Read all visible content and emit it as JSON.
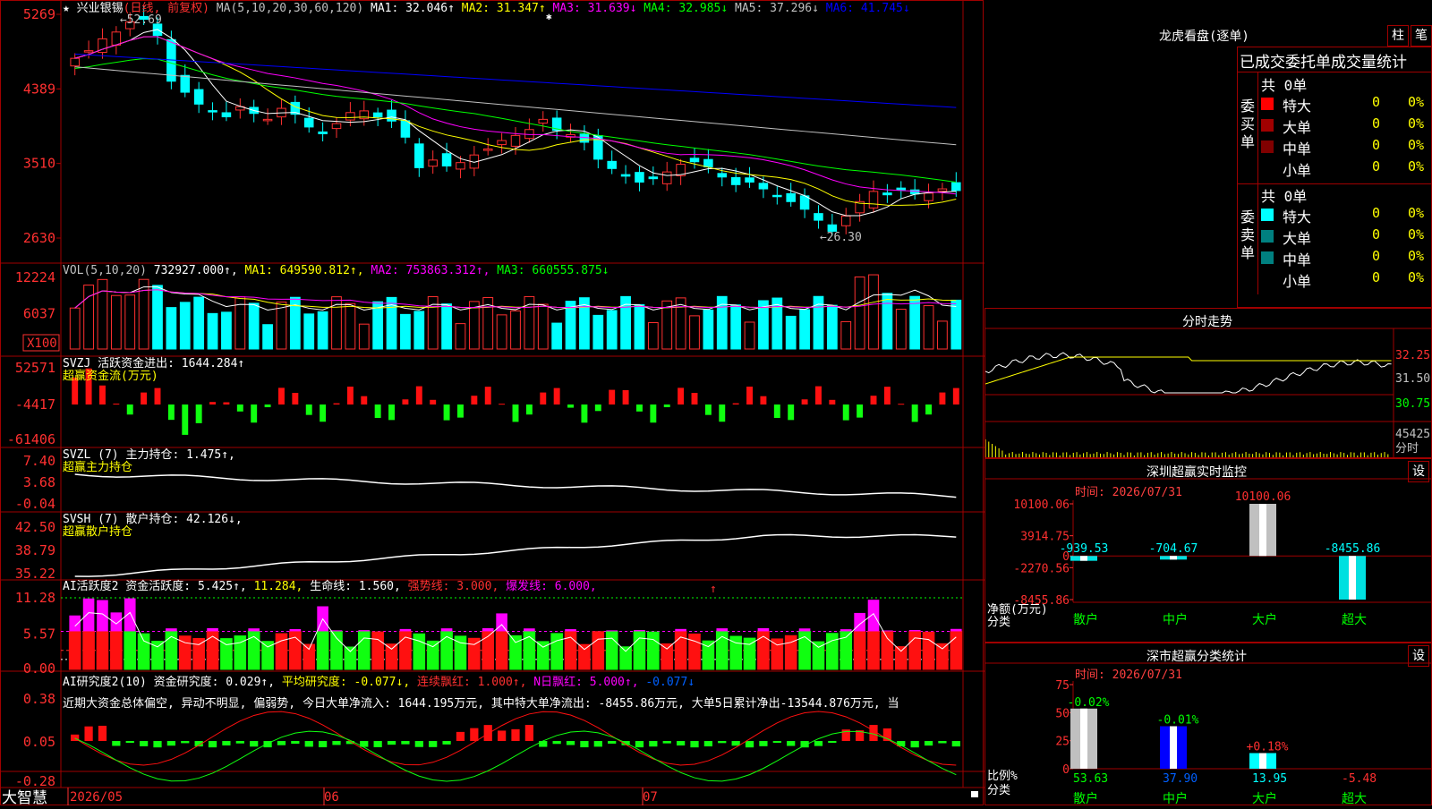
{
  "stock": {
    "star": "★",
    "name": "兴业银锡",
    "mode": "(日线, 前复权)",
    "ma_prefix": "MA(5,10,20,30,60,120)",
    "ma": [
      {
        "label": "MA1: 32.046↑",
        "color": "#ffffff"
      },
      {
        "label": "MA2: 31.347↑",
        "color": "#ffff00"
      },
      {
        "label": "MA3: 31.639↓",
        "color": "#ff00ff"
      },
      {
        "label": "MA4: 32.985↓",
        "color": "#00ff00"
      },
      {
        "label": "MA5: 37.296↓",
        "color": "#c0c0c0"
      },
      {
        "label": "MA6: 41.745↓",
        "color": "#0000ff"
      }
    ],
    "high_mark": "52.69",
    "low_mark": "26.30"
  },
  "price_axis": [
    "5269",
    "4389",
    "3510",
    "2630"
  ],
  "vol": {
    "header": "VOL(5,10,20)",
    "val": "732927.000↑",
    "ma1": "MA1: 649590.812↑",
    "ma2": "MA2: 753863.312↑",
    "ma3": "MA3: 660555.875↓",
    "axis": [
      "12224",
      "6037"
    ],
    "unit": "X100"
  },
  "svzj": {
    "header": "SVZJ  活跃资金进出: 1644.284↑",
    "sub": "超赢资金流(万元)",
    "axis": [
      "52571",
      "-4417",
      "-61406"
    ]
  },
  "svzl": {
    "header": "SVZL (7) 主力持仓: 1.475↑,",
    "sub": "超赢主力持仓",
    "axis": [
      "7.40",
      "3.68",
      "-0.04"
    ]
  },
  "svsh": {
    "header": "SVSH (7) 散户持仓: 42.126↓,",
    "sub": "超赢散户持仓",
    "axis": [
      "42.50",
      "38.79",
      "35.22"
    ]
  },
  "ai1": {
    "h1": "AI活跃度2 资金活跃度: 5.425↑,",
    "h2": "11.284,",
    "h3": "生命线: 1.560,",
    "h4": "强势线: 3.000,",
    "h5": "爆发线: 6.000,",
    "axis": [
      "11.28",
      "5.57",
      "0.00"
    ]
  },
  "ai2": {
    "h1": "AI研究度2(10) 资金研究度: 0.029↑",
    "h2": "平均研究度: -0.077↓",
    "h3": "连续飘红: 1.000↑",
    "h4": "N日飘红: 5.000↑",
    "h5": "-0.077↓",
    "comment": "近期大资金总体偏空, 异动不明显, 偏弱势, 今日大单净流入: 1644.195万元, 其中特大单净流出: -8455.86万元, 大单5日累计净出-13544.876万元, 当",
    "axis": [
      "0.38",
      "0.05",
      "-0.28"
    ]
  },
  "xaxis": {
    "logo": "大智慧",
    "dates": [
      "2026/05",
      "06",
      "07"
    ]
  },
  "dragon": {
    "title": "龙虎看盘(逐单)",
    "btn1": "柱",
    "btn2": "笔",
    "subtitle": "已成交委托单成交量统计",
    "buy": {
      "side": "委买单",
      "total": "共 0单",
      "rows": [
        {
          "name": "特大",
          "v": "0",
          "p": "0%",
          "color": "#ff0000"
        },
        {
          "name": "大单",
          "v": "0",
          "p": "0%",
          "color": "#a00000"
        },
        {
          "name": "中单",
          "v": "0",
          "p": "0%",
          "color": "#800000"
        },
        {
          "name": "小单",
          "v": "0",
          "p": "0%",
          "color": "#000000"
        }
      ]
    },
    "sell": {
      "side": "委卖单",
      "total": "共 0单",
      "rows": [
        {
          "name": "特大",
          "v": "0",
          "p": "0%",
          "color": "#00ffff"
        },
        {
          "name": "大单",
          "v": "0",
          "p": "0%",
          "color": "#008080"
        },
        {
          "name": "中单",
          "v": "0",
          "p": "0%",
          "color": "#008080"
        },
        {
          "name": "小单",
          "v": "0",
          "p": "0%",
          "color": "#000000"
        }
      ]
    }
  },
  "intraday": {
    "title": "分时走势",
    "axis": [
      "32.25",
      "31.50",
      "30.75",
      "45425",
      "分时"
    ]
  },
  "monitor": {
    "title": "深圳超赢实时监控",
    "btn": "设",
    "time": "时间: 2026/07/31",
    "axis": [
      "10100.06",
      "3914.75",
      "0",
      "-2270.56",
      "-8455.86"
    ],
    "ylabel": "净额(万元)",
    "xlabel": "分类",
    "cats": [
      "散户",
      "中户",
      "大户",
      "超大"
    ],
    "values": [
      "-939.53",
      "-704.67",
      "10100.06",
      "-8455.86"
    ]
  },
  "classify": {
    "title": "深市超赢分类统计",
    "btn": "设",
    "time": "时间: 2026/07/31",
    "axis": [
      "75",
      "50",
      "25",
      "0"
    ],
    "ylabel": "比例%",
    "xlabel": "分类",
    "cats": [
      "散户",
      "中户",
      "大户",
      "超大"
    ],
    "top": [
      "-0.02%",
      "-0.01%",
      "+0.18%",
      ""
    ],
    "values": [
      "53.63",
      "37.90",
      "13.95",
      "-5.48"
    ]
  },
  "chart_data": [
    {
      "type": "candlestick",
      "title": "兴业银锡(日线, 前复权)",
      "ylim": [
        26.3,
        52.69
      ],
      "x": [
        "2026/05",
        "",
        "",
        "",
        "",
        "",
        "",
        "",
        "",
        "",
        "",
        "",
        "",
        "",
        "",
        "",
        "",
        "",
        "",
        "",
        "",
        "06",
        "",
        "",
        "",
        "",
        "",
        "",
        "",
        "",
        "",
        "",
        "",
        "",
        "",
        "",
        "",
        "",
        "",
        "",
        "",
        "07",
        "",
        "",
        "",
        "",
        "",
        "",
        "",
        "",
        "",
        "",
        "",
        "",
        "",
        "",
        "",
        "",
        "",
        "",
        "",
        ""
      ],
      "close_approx": [
        47.5,
        48.4,
        49.8,
        50.6,
        51.8,
        52.1,
        50.2,
        44.8,
        43.5,
        42.1,
        41.2,
        40.6,
        41.8,
        41.0,
        40.3,
        41.6,
        40.9,
        39.4,
        38.6,
        39.8,
        41.1,
        41.3,
        40.6,
        40.1,
        38.2,
        34.6,
        35.5,
        34.8,
        35.2,
        36.1,
        36.8,
        37.8,
        38.4,
        39.1,
        40.3,
        39.0,
        38.5,
        37.6,
        35.6,
        34.5,
        33.6,
        32.9,
        33.3,
        34.1,
        35.0,
        35.3,
        34.7,
        33.5,
        32.6,
        32.9,
        32.1,
        31.2,
        30.6,
        29.7,
        28.4,
        27.1,
        28.9,
        30.6,
        31.8,
        31.4,
        32.0,
        31.5,
        31.6,
        32.1,
        31.9
      ],
      "high_marker": 52.69,
      "low_marker": 26.3
    },
    {
      "type": "bar",
      "title": "VOL(5,10,20)",
      "unit": "X100",
      "ylim": [
        0,
        12224
      ]
    },
    {
      "type": "bar",
      "title": "超赢资金流(万元)",
      "ylim": [
        -61406,
        52571
      ]
    },
    {
      "type": "bar",
      "title": "深圳超赢实时监控",
      "categories": [
        "散户",
        "中户",
        "大户",
        "超大"
      ],
      "values": [
        -939.53,
        -704.67,
        10100.06,
        -8455.86
      ],
      "ylabel": "净额(万元)",
      "xlabel": "分类",
      "ylim": [
        -8455.86,
        10100.06
      ]
    },
    {
      "type": "bar",
      "title": "深市超赢分类统计",
      "categories": [
        "散户",
        "中户",
        "大户",
        "超大"
      ],
      "values": [
        53.63,
        37.9,
        13.95,
        -5.48
      ],
      "ylabel": "比例%",
      "xlabel": "分类",
      "ylim": [
        0,
        75
      ]
    }
  ]
}
